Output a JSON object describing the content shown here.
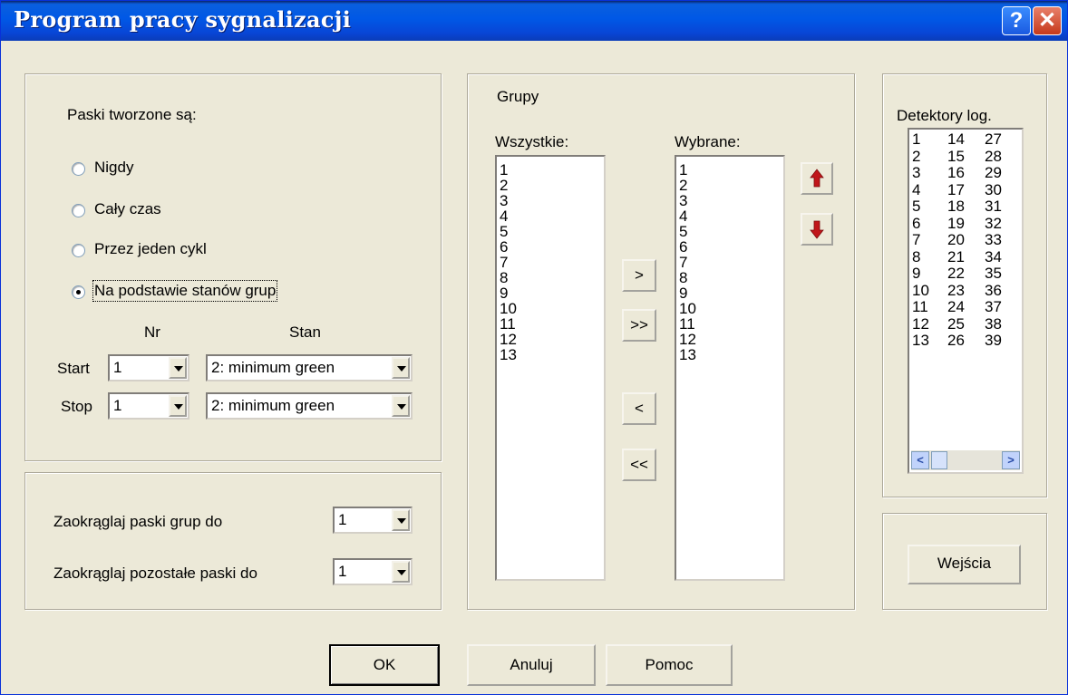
{
  "window": {
    "title": "Program pracy sygnalizacji"
  },
  "titlebar_buttons": {
    "help": "?",
    "close": "✕"
  },
  "paski": {
    "heading": "Paski tworzone są:",
    "options": [
      "Nigdy",
      "Cały czas",
      "Przez jeden cykl",
      "Na podstawie stanów grup"
    ],
    "selected_index": 3,
    "col_nr": "Nr",
    "col_stan": "Stan",
    "start_label": "Start",
    "stop_label": "Stop",
    "start_nr": "1",
    "start_stan": "2: minimum green",
    "stop_nr": "1",
    "stop_stan": "2: minimum green"
  },
  "rounding": {
    "groups_label": "Zaokrąglaj paski grup do",
    "groups_value": "1",
    "others_label": "Zaokrąglaj pozostałe paski do",
    "others_value": "1"
  },
  "grupy": {
    "heading": "Grupy",
    "all_label": "Wszystkie:",
    "selected_label": "Wybrane:",
    "all_items": [
      "1",
      "2",
      "3",
      "4",
      "5",
      "6",
      "7",
      "8",
      "9",
      "10",
      "11",
      "12",
      "13"
    ],
    "selected_items": [
      "1",
      "2",
      "3",
      "4",
      "5",
      "6",
      "7",
      "8",
      "9",
      "10",
      "11",
      "12",
      "13"
    ],
    "btn_add": ">",
    "btn_add_all": ">>",
    "btn_remove": "<",
    "btn_remove_all": "<<"
  },
  "detektory": {
    "heading": "Detektory log.",
    "col1": [
      "1",
      "2",
      "3",
      "4",
      "5",
      "6",
      "7",
      "8",
      "9",
      "10",
      "11",
      "12",
      "13"
    ],
    "col2": [
      "14",
      "15",
      "16",
      "17",
      "18",
      "19",
      "20",
      "21",
      "22",
      "23",
      "24",
      "25",
      "26"
    ],
    "col3": [
      "27",
      "28",
      "29",
      "30",
      "31",
      "32",
      "33",
      "34",
      "35",
      "36",
      "37",
      "38",
      "39"
    ],
    "wejscia": "Wejścia"
  },
  "footer": {
    "ok": "OK",
    "cancel": "Anuluj",
    "help": "Pomoc"
  },
  "colors": {
    "titlebar": "#0058e6",
    "face": "#ece9d8",
    "arrow_red": "#c0161a"
  }
}
